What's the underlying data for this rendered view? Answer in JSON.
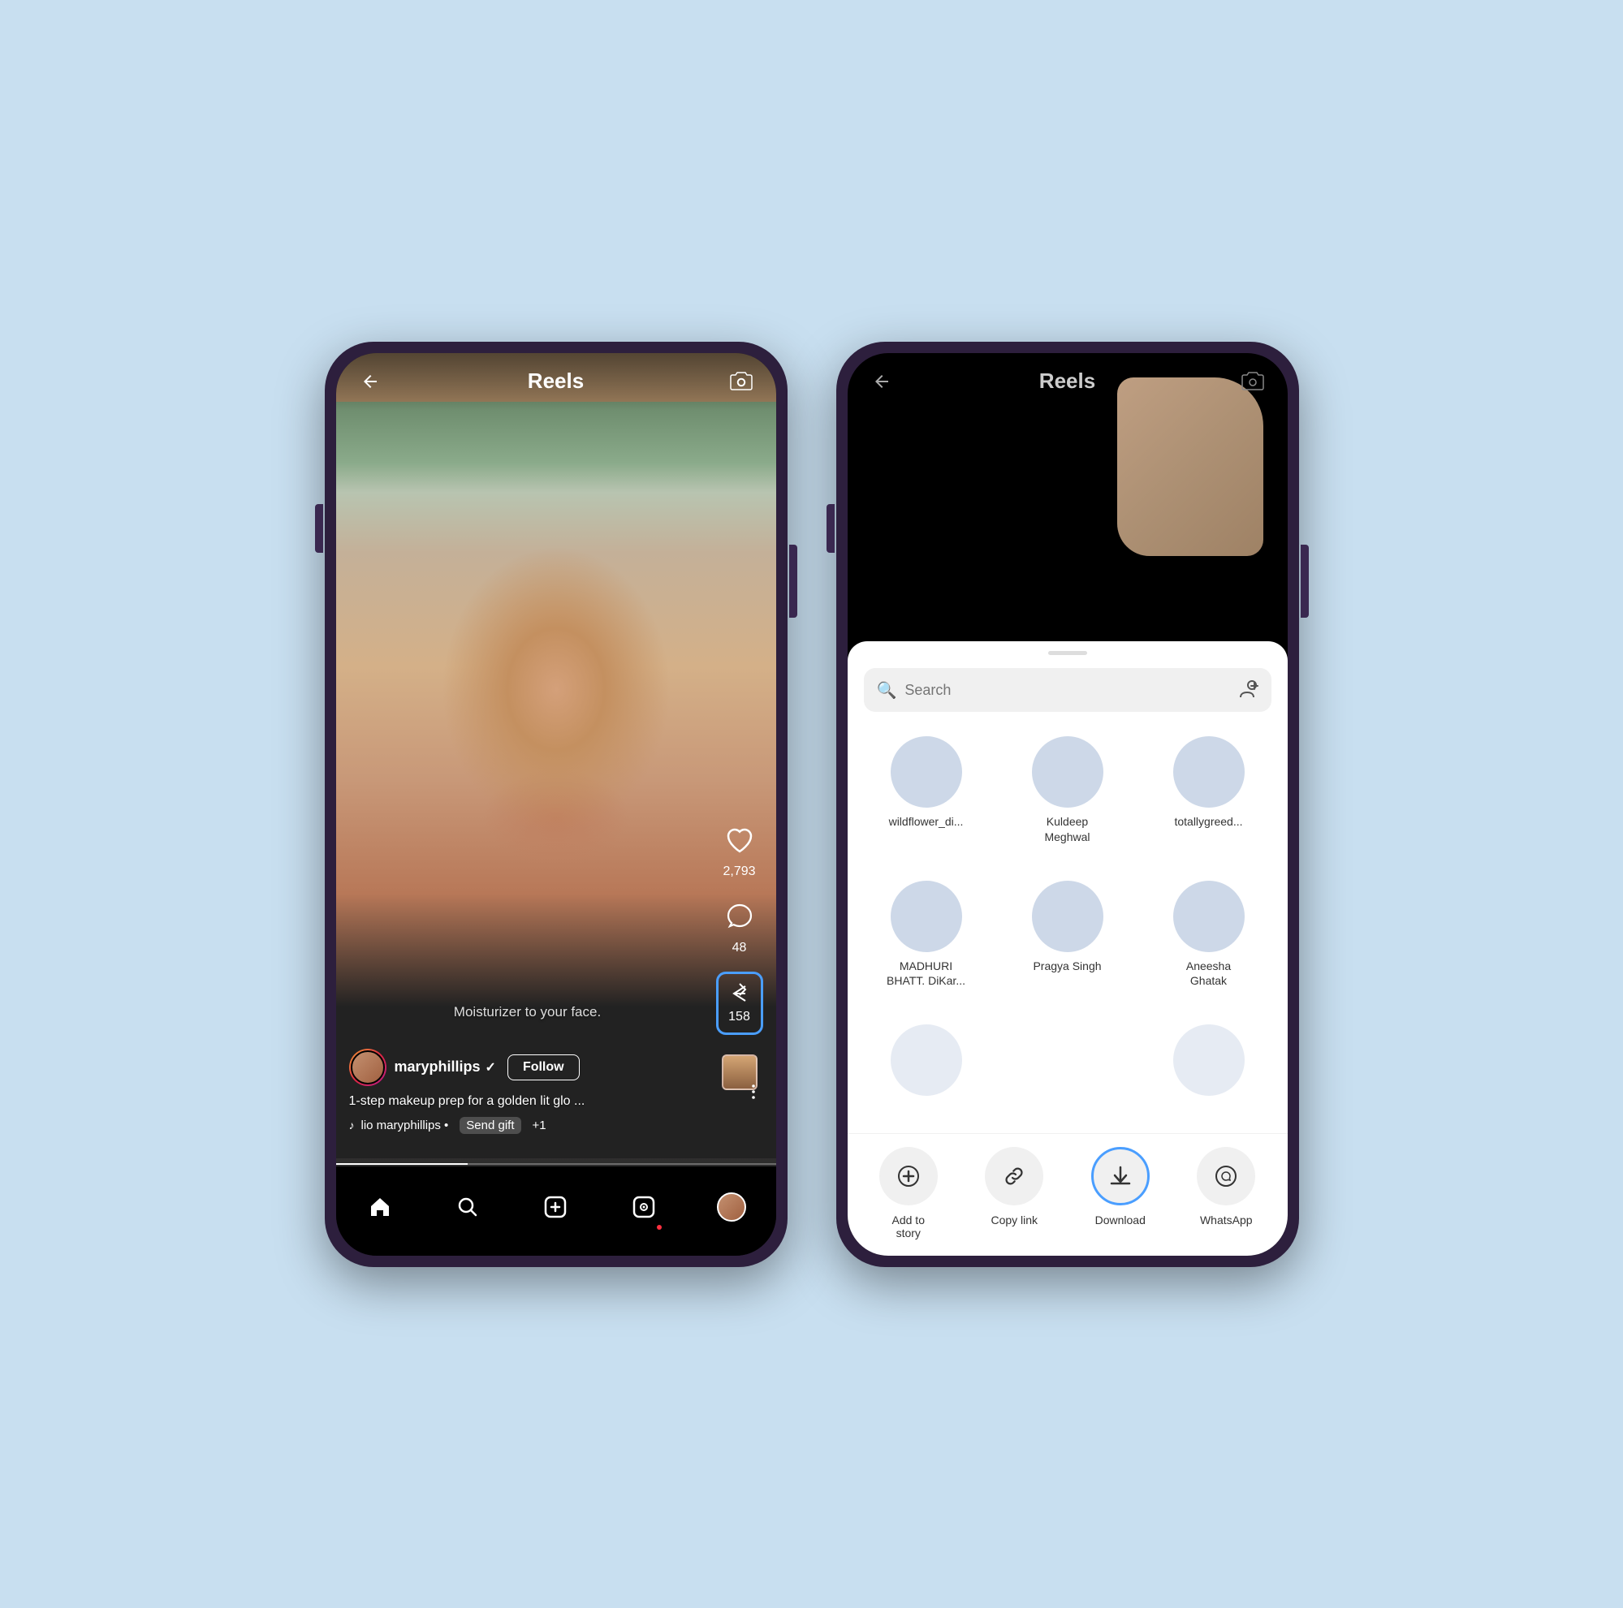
{
  "phone1": {
    "topBar": {
      "title": "Reels",
      "backIcon": "←",
      "cameraIcon": "📷"
    },
    "video": {
      "subtitleText": "Moisturizer to your face."
    },
    "actions": {
      "likes": "2,793",
      "comments": "48",
      "shares": "158"
    },
    "user": {
      "username": "maryphillips",
      "verified": true,
      "followLabel": "Follow",
      "caption": "1-step makeup prep for a golden lit glo ...",
      "music": "lio  maryphillips •",
      "sendGift": "Send gift",
      "plusMore": "+1"
    },
    "bottomNav": {
      "items": [
        "home",
        "search",
        "plus",
        "reels",
        "profile"
      ]
    }
  },
  "phone2": {
    "topBar": {
      "title": "Reels",
      "backIcon": "←",
      "cameraIcon": "📷"
    },
    "sheet": {
      "searchPlaceholder": "Search",
      "contacts": [
        {
          "name": "wildflower_di..."
        },
        {
          "name": "Kuldeep\nMeghwal"
        },
        {
          "name": "totallygreed..."
        },
        {
          "name": "MADHURI\nBHATT. DiKar..."
        },
        {
          "name": "Pragya Singh"
        },
        {
          "name": "Aneesha\nGhatak"
        }
      ],
      "actions": [
        {
          "id": "add-story",
          "label": "Add to\nstory",
          "icon": "⊕"
        },
        {
          "id": "copy-link",
          "label": "Copy link",
          "icon": "🔗"
        },
        {
          "id": "download",
          "label": "Download",
          "icon": "⬇",
          "highlighted": true
        },
        {
          "id": "whatsapp",
          "label": "WhatsApp",
          "icon": "💬"
        }
      ]
    }
  }
}
